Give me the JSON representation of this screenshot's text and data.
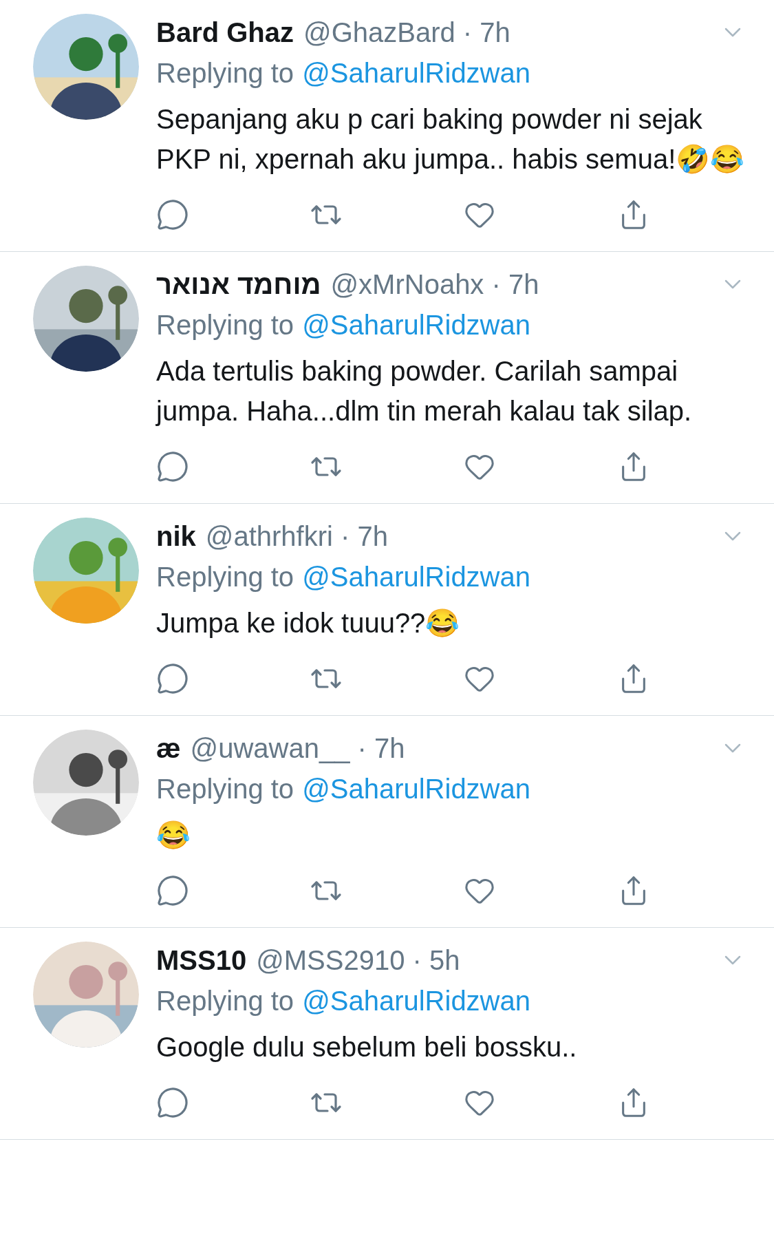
{
  "tweets": [
    {
      "name": "Bard Ghaz",
      "meta": "@GhazBard · 7h",
      "replying_label": "Replying to",
      "reply_to": "@SaharulRidzwan",
      "text": "Sepanjang aku p cari baking powder ni sejak PKP ni, xpernah aku jumpa.. habis semua!🤣😂"
    },
    {
      "name": "מוחמד אנואר",
      "meta": "@xMrNoahx · 7h",
      "replying_label": "Replying to",
      "reply_to": "@SaharulRidzwan",
      "text": "Ada tertulis baking powder. Carilah sampai jumpa. Haha...dlm tin merah kalau tak silap."
    },
    {
      "name": "nik",
      "meta": "@athrhfkri · 7h",
      "replying_label": "Replying to",
      "reply_to": "@SaharulRidzwan",
      "text": "Jumpa ke idok tuuu??😂"
    },
    {
      "name": "æ",
      "meta": "@uwawan__ · 7h",
      "replying_label": "Replying to",
      "reply_to": "@SaharulRidzwan",
      "text": "😂"
    },
    {
      "name": "MSS10",
      "meta": "@MSS2910 · 5h",
      "replying_label": "Replying to",
      "reply_to": "@SaharulRidzwan",
      "text": "Google dulu sebelum beli bossku.."
    }
  ]
}
